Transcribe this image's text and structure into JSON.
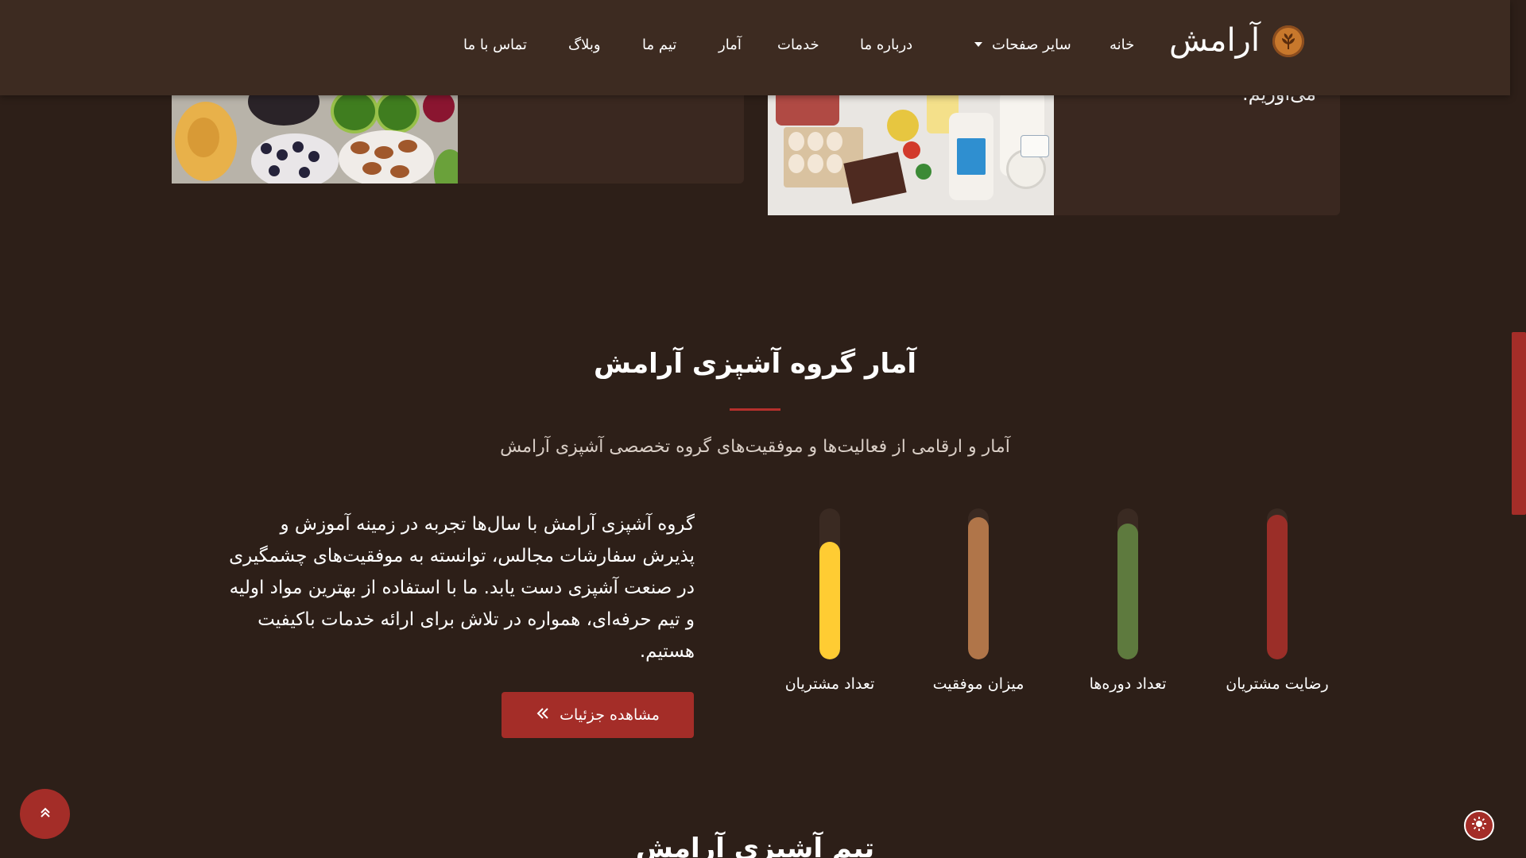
{
  "nav": {
    "brand": "آرامش",
    "links": {
      "home": "خانه",
      "other_pages": "سایر صفحات",
      "about": "درباره ما",
      "services": "خدمات",
      "stats": "آمار",
      "team": "تیم ما",
      "blog": "وبلاگ",
      "contact": "تماس با ما"
    }
  },
  "cards": {
    "right_text_tail": "می‌آوریم."
  },
  "stats_section": {
    "title": "آمار گروه آشپزی آرامش",
    "subtitle": "آمار و ارقامی از فعالیت‌ها و موفقیت‌های گروه تخصصی آشپزی آرامش",
    "bars": [
      {
        "label": "رضایت مشتریان",
        "value": 0.96,
        "color": "#9b2e28"
      },
      {
        "label": "تعداد دوره‌ها",
        "value": 0.9,
        "color": "#5e7a3e"
      },
      {
        "label": "میزان موفقیت",
        "value": 0.94,
        "color": "#b07549"
      },
      {
        "label": "تعداد مشتریان",
        "value": 0.78,
        "color": "#ffcc33"
      }
    ],
    "paragraph": "گروه آشپزی آرامش با سال‌ها تجربه در زمینه آموزش و پذیرش سفارشات مجالس، توانسته به موفقیت‌های چشمگیری در صنعت آشپزی دست یابد. ما با استفاده از بهترین مواد اولیه و تیم حرفه‌ای، همواره در تلاش برای ارائه خدمات باکیفیت هستیم.",
    "button_label": "مشاهده جزئیات",
    "button_icon": "double-chevron-left-icon"
  },
  "team_section": {
    "title": "تیم آشپزی آرامش"
  },
  "controls": {
    "back_to_top_icon": "double-chevron-up-icon",
    "theme_toggle_icon": "sun-icon"
  },
  "colors": {
    "background": "#2d1f18",
    "navbar": "#3d2b21",
    "accent": "#a42d28"
  }
}
